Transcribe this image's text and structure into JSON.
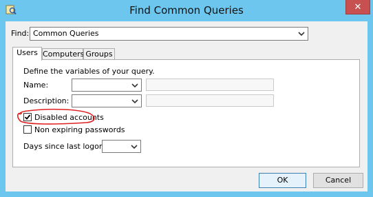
{
  "window": {
    "title": "Find Common Queries",
    "icon": "query-app-icon",
    "close_glyph": "✕"
  },
  "find": {
    "label": "Find:",
    "value": "Common Queries"
  },
  "tabs": [
    {
      "label": "Users"
    },
    {
      "label": "Computers"
    },
    {
      "label": "Groups"
    }
  ],
  "panel": {
    "description": "Define the variables of your query.",
    "name_label": "Name:",
    "name_value": "",
    "description_label": "Description:",
    "description_value": "",
    "disabled_accounts_label": "Disabled accounts",
    "disabled_accounts_checked": true,
    "non_expiring_label": "Non expiring passwords",
    "non_expiring_checked": false,
    "days_label": "Days since last logon:",
    "days_value": ""
  },
  "buttons": {
    "ok": "OK",
    "cancel": "Cancel"
  },
  "colors": {
    "frame": "#6cc6ee",
    "close": "#c75050",
    "annotation": "#e02020"
  }
}
